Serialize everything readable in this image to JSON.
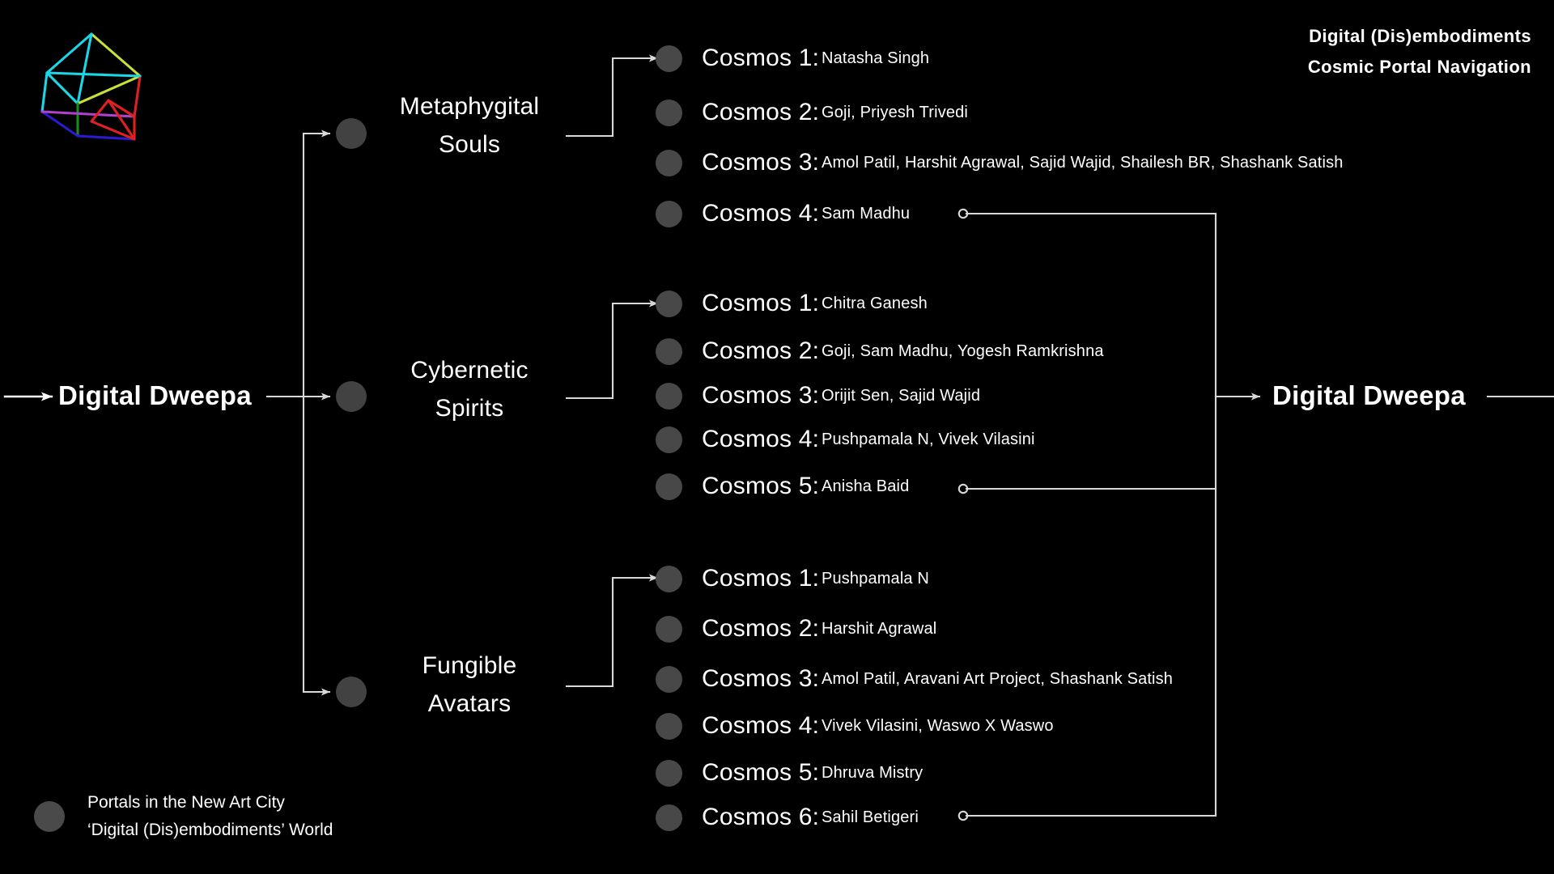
{
  "header": {
    "line1": "Digital (Dis)embodiments",
    "line2": "Cosmic Portal Navigation"
  },
  "logo": {
    "name": "polyhedron-wireframe-logo",
    "colors": [
      "#1ad7e8",
      "#c9e03a",
      "#e02020",
      "#1e8a1e",
      "#b040d0",
      "#2a1ad0"
    ]
  },
  "root": {
    "left_label": "Digital Dweepa",
    "right_label": "Digital Dweepa"
  },
  "branches": [
    {
      "id": "metaphygital-souls",
      "title_line1": "Metaphygital",
      "title_line2": "Souls",
      "cosmos": [
        {
          "label": "Cosmos 1:",
          "names": "Natasha Singh"
        },
        {
          "label": "Cosmos 2:",
          "names": "Goji, Priyesh Trivedi"
        },
        {
          "label": "Cosmos 3:",
          "names": "Amol Patil, Harshit Agrawal, Sajid Wajid, Shailesh BR, Shashank Satish"
        },
        {
          "label": "Cosmos 4:",
          "names": "Sam Madhu"
        }
      ]
    },
    {
      "id": "cybernetic-spirits",
      "title_line1": "Cybernetic",
      "title_line2": "Spirits",
      "cosmos": [
        {
          "label": "Cosmos 1:",
          "names": "Chitra Ganesh"
        },
        {
          "label": "Cosmos 2:",
          "names": "Goji, Sam Madhu, Yogesh Ramkrishna"
        },
        {
          "label": "Cosmos 3:",
          "names": "Orijit Sen, Sajid Wajid"
        },
        {
          "label": "Cosmos 4:",
          "names": "Pushpamala N, Vivek Vilasini"
        },
        {
          "label": "Cosmos 5:",
          "names": "Anisha Baid"
        }
      ]
    },
    {
      "id": "fungible-avatars",
      "title_line1": "Fungible",
      "title_line2": "Avatars",
      "cosmos": [
        {
          "label": "Cosmos 1:",
          "names": "Pushpamala N"
        },
        {
          "label": "Cosmos 2:",
          "names": "Harshit Agrawal"
        },
        {
          "label": "Cosmos 3:",
          "names": "Amol Patil, Aravani Art Project, Shashank Satish"
        },
        {
          "label": "Cosmos 4:",
          "names": "Vivek Vilasini, Waswo X Waswo"
        },
        {
          "label": "Cosmos 5:",
          "names": "Dhruva Mistry"
        },
        {
          "label": "Cosmos 6:",
          "names": "Sahil Betigeri"
        }
      ]
    }
  ],
  "legend": {
    "line1": "Portals in the New Art City",
    "line2": "‘Digital (Dis)embodiments’ World"
  },
  "colors": {
    "background": "#000000",
    "text": "#ffffff",
    "node_dot": "#484848",
    "wire": "#d8d8d8"
  }
}
